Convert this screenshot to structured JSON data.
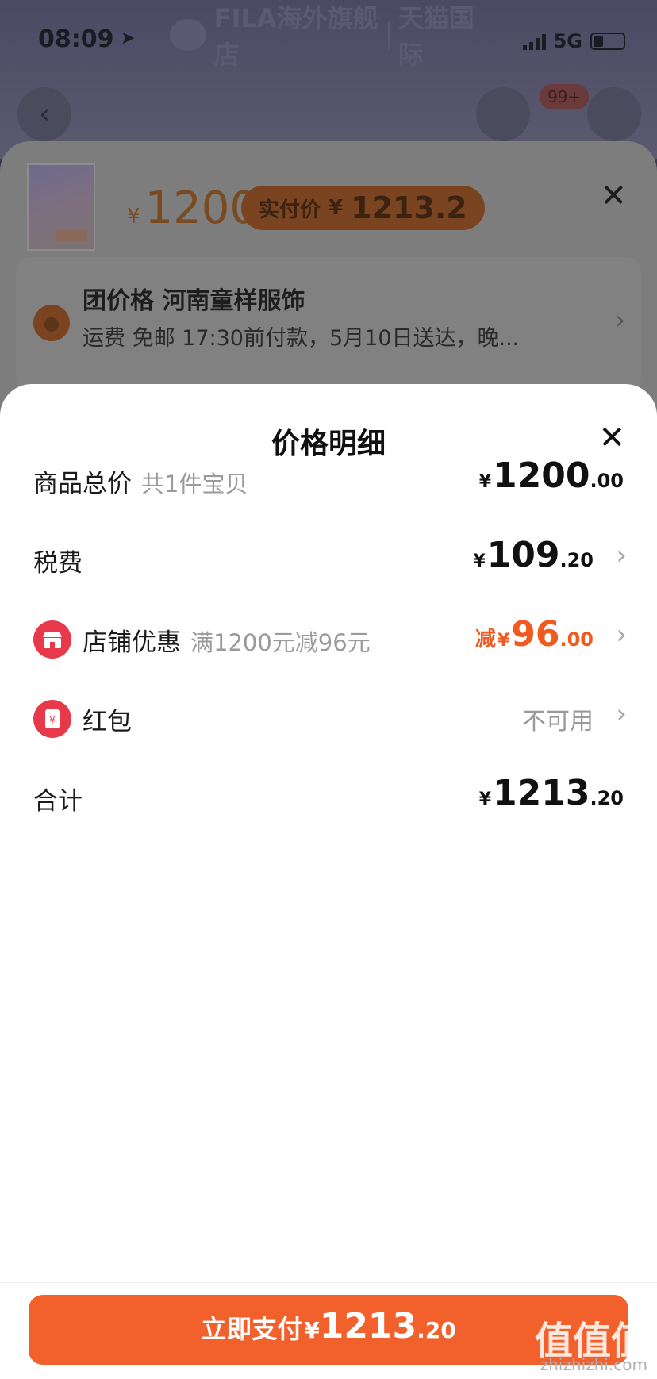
{
  "status_bar": {
    "time": "08:09",
    "network": "5G"
  },
  "store_banner": {
    "name": "FILA海外旗舰店",
    "platform": "天猫国际"
  },
  "background_header": {
    "cart_badge": "99+"
  },
  "sku_panel": {
    "price": "1200",
    "price_currency": "¥",
    "paid_price_label": "实付价",
    "paid_price_currency": "¥",
    "paid_price_value": "1213.2",
    "address_title": "团价格 河南童样服饰",
    "address_sub": "运费 免邮 17:30前付款，5月10日送达，晚..."
  },
  "price_detail": {
    "title": "价格明细",
    "rows": [
      {
        "label": "商品总价",
        "hint": "共1件宝贝",
        "currency": "¥",
        "int": "1200",
        "dec": ".00"
      },
      {
        "label": "税费",
        "currency": "¥",
        "int": "109",
        "dec": ".20"
      },
      {
        "label": "店铺优惠",
        "hint": "满1200元减96元",
        "prefix": "减",
        "currency": "¥",
        "int": "96",
        "dec": ".00"
      },
      {
        "label": "红包",
        "value_text": "不可用"
      },
      {
        "label": "合计",
        "currency": "¥",
        "int": "1213",
        "dec": ".20"
      }
    ]
  },
  "pay_button": {
    "label": "立即支付",
    "currency": "¥",
    "int": "1213",
    "dec": ".20"
  },
  "watermark": {
    "text": "值值值",
    "sub": "zhizhizhi.com"
  },
  "colors": {
    "accent": "#f2602b",
    "discount": "#f05a1e",
    "shop_icon": "#e8394a",
    "hongbao_icon": "#e8394a"
  }
}
